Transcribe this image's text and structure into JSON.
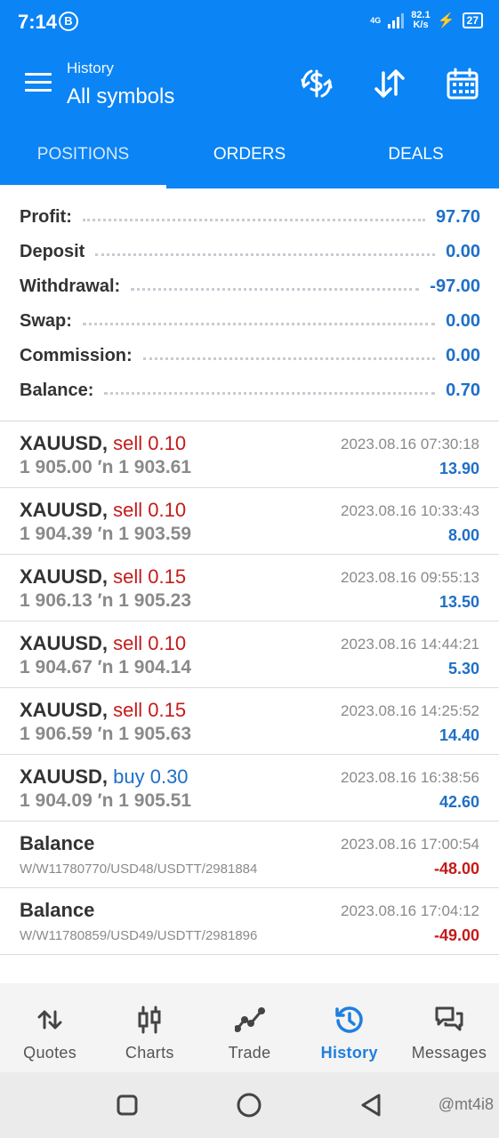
{
  "status_bar": {
    "time": "7:14",
    "badge": "B",
    "network": "4G",
    "speed_value": "82.1",
    "speed_unit": "K/s",
    "battery": "27"
  },
  "header": {
    "subtitle": "History",
    "title": "All symbols",
    "icons": [
      "currency-exchange-icon",
      "sort-icon",
      "calendar-icon"
    ]
  },
  "tabs": [
    {
      "label": "POSITIONS",
      "active": true
    },
    {
      "label": "ORDERS",
      "active": false
    },
    {
      "label": "DEALS",
      "active": false
    }
  ],
  "summary": [
    {
      "label": "Profit:",
      "value": "97.70"
    },
    {
      "label": "Deposit",
      "value": "0.00"
    },
    {
      "label": "Withdrawal:",
      "value": "-97.00"
    },
    {
      "label": "Swap:",
      "value": "0.00"
    },
    {
      "label": "Commission:",
      "value": "0.00"
    },
    {
      "label": "Balance:",
      "value": "0.70"
    }
  ],
  "deals": [
    {
      "symbol": "XAUUSD,",
      "side": "sell 0.10",
      "prices": "1 905.00 ′n  1 903.61",
      "time": "2023.08.16 07:30:18",
      "profit": "13.90"
    },
    {
      "symbol": "XAUUSD,",
      "side": "sell 0.10",
      "prices": "1 904.39 ′n  1 903.59",
      "time": "2023.08.16 10:33:43",
      "profit": "8.00"
    },
    {
      "symbol": "XAUUSD,",
      "side": "sell 0.15",
      "prices": "1 906.13 ′n  1 905.23",
      "time": "2023.08.16 09:55:13",
      "profit": "13.50"
    },
    {
      "symbol": "XAUUSD,",
      "side": "sell 0.10",
      "prices": "1 904.67 ′n  1 904.14",
      "time": "2023.08.16 14:44:21",
      "profit": "5.30"
    },
    {
      "symbol": "XAUUSD,",
      "side": "sell 0.15",
      "prices": "1 906.59 ′n  1 905.63",
      "time": "2023.08.16 14:25:52",
      "profit": "14.40"
    },
    {
      "symbol": "XAUUSD,",
      "side": "buy 0.30",
      "prices": "1 904.09 ′n  1 905.51",
      "time": "2023.08.16 16:38:56",
      "profit": "42.60"
    },
    {
      "symbol": "Balance",
      "comment": "W/W11780770/USD48/USDTT/2981884",
      "time": "2023.08.16 17:00:54",
      "profit": "-48.00"
    },
    {
      "symbol": "Balance",
      "comment": "W/W11780859/USD49/USDTT/2981896",
      "time": "2023.08.16 17:04:12",
      "profit": "-49.00"
    }
  ],
  "bottom_nav": [
    {
      "label": "Quotes",
      "icon": "quotes-icon"
    },
    {
      "label": "Charts",
      "icon": "candlestick-icon"
    },
    {
      "label": "Trade",
      "icon": "trade-line-icon"
    },
    {
      "label": "History",
      "icon": "history-icon",
      "active": true
    },
    {
      "label": "Messages",
      "icon": "messages-icon"
    }
  ],
  "watermark": "@mt4i8",
  "colors": {
    "brand": "#0b84f5",
    "profit": "#1e6fc8",
    "loss": "#c61a1a"
  }
}
